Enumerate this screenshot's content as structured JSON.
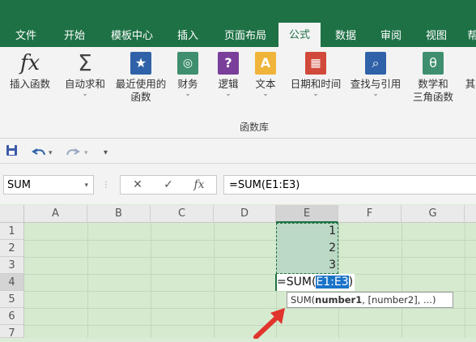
{
  "ribbon_tabs": [
    "文件",
    "开始",
    "模板中心",
    "插入",
    "页面布局",
    "公式",
    "数据",
    "审阅",
    "视图",
    "帮"
  ],
  "active_tab": "公式",
  "ribbon_buttons": {
    "insert_function": "插入函数",
    "autosum": "自动求和",
    "recent_line1": "最近使用的",
    "recent_line2": "函数",
    "financial": "财务",
    "logical": "逻辑",
    "text": "文本",
    "datetime": "日期和时间",
    "lookup": "查找与引用",
    "math_line1": "数学和",
    "math_line2": "三角函数",
    "more": "其"
  },
  "ribbon_group_label": "函数库",
  "name_box": "SUM",
  "formula_bar": {
    "cancel_glyph": "✕",
    "enter_glyph": "✓",
    "fx_glyph": "fx",
    "value": "=SUM(E1:E3)"
  },
  "columns": [
    "A",
    "B",
    "C",
    "D",
    "E",
    "F",
    "G"
  ],
  "rows": [
    "1",
    "2",
    "3",
    "4",
    "5",
    "6",
    "7"
  ],
  "cells": {
    "E1": "1",
    "E2": "2",
    "E3": "3",
    "E4_prefix": "=SUM(",
    "E4_ref": "E1:E3",
    "E4_suffix": ")"
  },
  "tooltip": {
    "func": "SUM(",
    "arg1": "number1",
    "rest": ", [number2], ...)"
  },
  "colors": {
    "tab_bar": "#1e7145",
    "sheet_bg": "#d6ead0",
    "range_highlight": "#1a73c8",
    "annotation_arrow": "#e0342c"
  }
}
